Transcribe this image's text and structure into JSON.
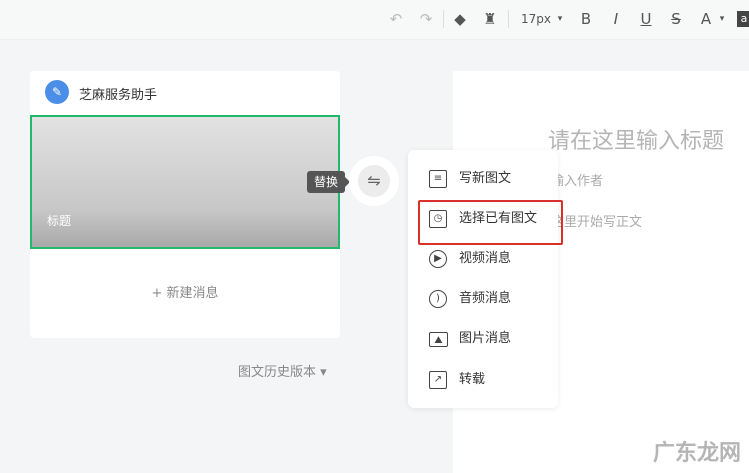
{
  "toolbar": {
    "undo": "↶",
    "redo": "↷",
    "eraser": "◆",
    "format_brush": "♜",
    "font_size": "17px",
    "dropdown": "▾",
    "bold": "B",
    "italic": "I",
    "underline": "U",
    "strike": "S",
    "font_color": "A",
    "bg_color": "a"
  },
  "account": {
    "name": "芝麻服务助手",
    "logo": "✎"
  },
  "cover": {
    "title": "标题"
  },
  "new_message": "+ 新建消息",
  "history": "图文历史版本 ▾",
  "replace_tooltip": "替换",
  "swap_icon": "⇋",
  "editor": {
    "title_placeholder": "请在这里输入标题",
    "author_placeholder": "请输入作者",
    "body_placeholder": "从这里开始写正文"
  },
  "menu": [
    {
      "label": "写新图文",
      "icon": "≡"
    },
    {
      "label": "选择已有图文",
      "icon": "◷"
    },
    {
      "label": "视频消息",
      "icon": "▶"
    },
    {
      "label": "音频消息",
      "icon": ")"
    },
    {
      "label": "图片消息",
      "icon": "⛰"
    },
    {
      "label": "转载",
      "icon": "↗"
    }
  ],
  "watermark": "广东龙网",
  "colors": {
    "accent_green": "#1fba6a",
    "highlight_red": "#d9302a"
  }
}
